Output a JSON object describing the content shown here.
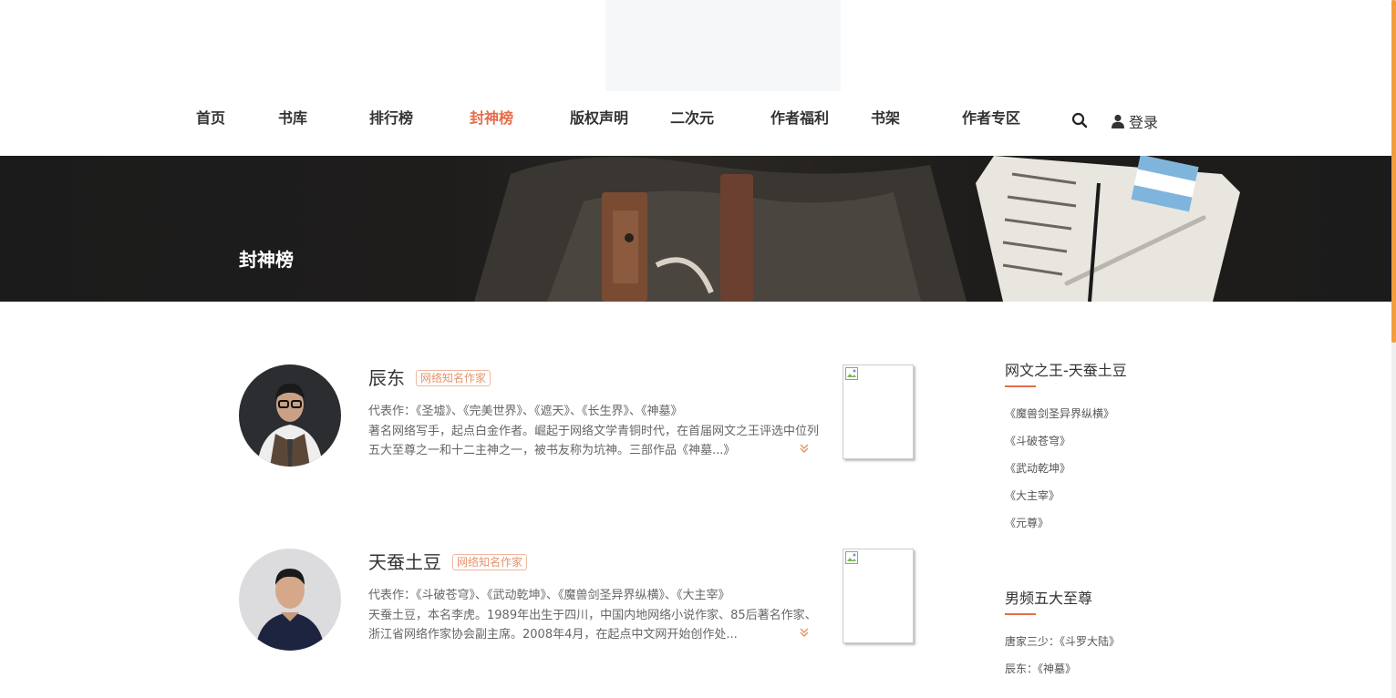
{
  "nav": {
    "items": [
      {
        "label": "首页",
        "active": false
      },
      {
        "label": "书库",
        "active": false
      },
      {
        "label": "排行榜",
        "active": false
      },
      {
        "label": "封神榜",
        "active": true
      },
      {
        "label": "版权声明",
        "active": false
      },
      {
        "label": "二次元",
        "active": false
      },
      {
        "label": "作者福利",
        "active": false
      },
      {
        "label": "书架",
        "active": false
      },
      {
        "label": "作者专区",
        "active": false
      }
    ],
    "login_label": "登录"
  },
  "banner": {
    "title": "封神榜"
  },
  "authors": [
    {
      "name": "辰东",
      "badge": "网络知名作家",
      "works": "代表作：《圣墟》、《完美世界》、《遮天》、《长生界》、《神墓》",
      "desc": "著名网络写手，起点白金作者。崛起于网络文学青铜时代，在首届网文之王评选中位列五大至尊之一和十二主神之一，被书友称为坑神。三部作品《神墓...》"
    },
    {
      "name": "天蚕土豆",
      "badge": "网络知名作家",
      "works": "代表作：《斗破苍穹》、《武动乾坤》、《魔兽剑圣异界纵横》、《大主宰》",
      "desc": "天蚕土豆，本名李虎。1989年出生于四川，中国内地网络小说作家、85后著名作家、浙江省网络作家协会副主席。2008年4月，在起点中文网开始创作处..."
    }
  ],
  "sidebar": {
    "section1": {
      "title": "网文之王-天蚕土豆",
      "items": [
        "《魔兽剑圣异界纵横》",
        "《斗破苍穹》",
        "《武动乾坤》",
        "《大主宰》",
        "《元尊》"
      ]
    },
    "section2": {
      "title": "男频五大至尊",
      "items": [
        "唐家三少：《斗罗大陆》",
        "辰东：《神墓》"
      ]
    }
  },
  "colors": {
    "accent": "#e56c49",
    "scroll_thumb": "#f39c3c",
    "banner_bg": "#1c1b1b"
  }
}
